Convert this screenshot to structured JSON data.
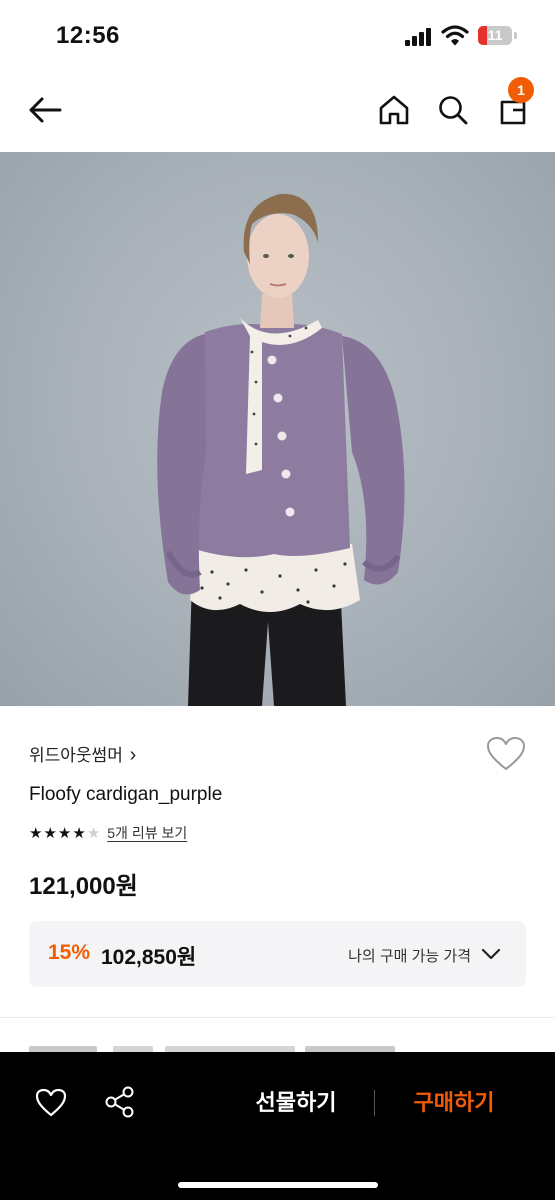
{
  "status_bar": {
    "time": "12:56",
    "battery": "11",
    "battery_color": "#e5322d"
  },
  "nav": {
    "back_icon": "arrow-left-icon",
    "home_icon": "home-icon",
    "search_icon": "search-icon",
    "cart_icon": "shopping-bag-icon",
    "cart_count": "1",
    "badge_color": "#f25c05"
  },
  "product": {
    "image_description_icon": "product-photo",
    "brand": "위드아웃썸머",
    "brand_chevron": "›",
    "name": "Floofy cardigan_purple",
    "rating": 4,
    "rating_max": 5,
    "review_link": "5개 리뷰 보기",
    "price": "121,000원",
    "discount_rate": "15%",
    "discount_price": "102,850원",
    "my_price_label": "나의 구매 가능 가격",
    "accent_color": "#f25c05"
  },
  "bottom_bar": {
    "wish_icon": "heart-outline-icon",
    "share_icon": "share-icon",
    "gift_label": "선물하기",
    "buy_label": "구매하기"
  }
}
